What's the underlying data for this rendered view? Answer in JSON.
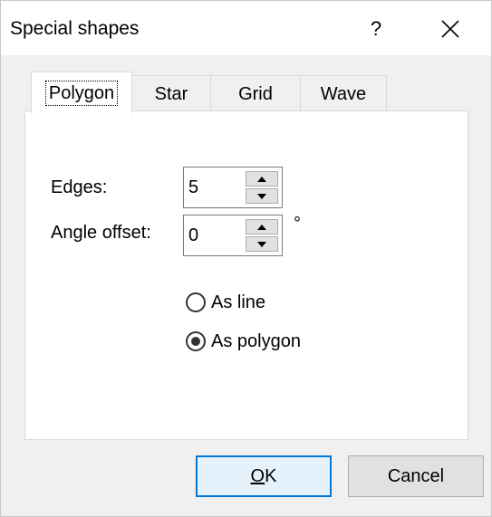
{
  "window": {
    "title": "Special shapes",
    "help_label": "?"
  },
  "tabs": [
    {
      "label": "Polygon",
      "active": true
    },
    {
      "label": "Star",
      "active": false
    },
    {
      "label": "Grid",
      "active": false
    },
    {
      "label": "Wave",
      "active": false
    }
  ],
  "polygon": {
    "edges": {
      "label": "Edges:",
      "value": "5"
    },
    "angle_offset": {
      "label": "Angle offset:",
      "value": "0",
      "unit": "°"
    },
    "draw_mode": {
      "options": [
        {
          "label": "As line",
          "checked": false
        },
        {
          "label": "As polygon",
          "checked": true
        }
      ]
    }
  },
  "buttons": {
    "ok": {
      "label_mnemonic": "O",
      "label_rest": "K"
    },
    "cancel": {
      "label": "Cancel"
    }
  },
  "colors": {
    "accent": "#0078d7",
    "window_bg": "#f0f0f0",
    "panel_bg": "#ffffff"
  }
}
